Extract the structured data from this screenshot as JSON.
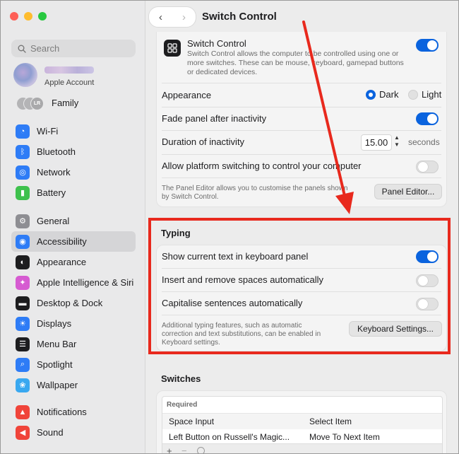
{
  "window": {
    "title": "Switch Control"
  },
  "search": {
    "placeholder": "Search"
  },
  "account": {
    "label": "Apple Account"
  },
  "family": {
    "label": "Family",
    "initials": [
      "",
      "",
      "LR"
    ]
  },
  "sidebar": {
    "group1": [
      {
        "label": "Wi-Fi",
        "icon": "wifi-icon",
        "color": "#2e7cf6"
      },
      {
        "label": "Bluetooth",
        "icon": "bluetooth-icon",
        "color": "#2e7cf6"
      },
      {
        "label": "Network",
        "icon": "globe-icon",
        "color": "#2e7cf6"
      },
      {
        "label": "Battery",
        "icon": "battery-icon",
        "color": "#3ec14d"
      }
    ],
    "group2": [
      {
        "label": "General",
        "icon": "gear-icon",
        "color": "#8e8e93"
      },
      {
        "label": "Accessibility",
        "icon": "accessibility-icon",
        "color": "#2e7cf6",
        "active": true
      },
      {
        "label": "Appearance",
        "icon": "appearance-icon",
        "color": "#1d1d1f"
      },
      {
        "label": "Apple Intelligence & Siri",
        "icon": "siri-icon",
        "color": "#d65bd1"
      },
      {
        "label": "Desktop & Dock",
        "icon": "dock-icon",
        "color": "#1d1d1f"
      },
      {
        "label": "Displays",
        "icon": "sun-icon",
        "color": "#2e7cf6"
      },
      {
        "label": "Menu Bar",
        "icon": "menubar-icon",
        "color": "#1d1d1f"
      },
      {
        "label": "Spotlight",
        "icon": "search-icon",
        "color": "#2e7cf6"
      },
      {
        "label": "Wallpaper",
        "icon": "wallpaper-icon",
        "color": "#39a8f0"
      }
    ],
    "group3": [
      {
        "label": "Notifications",
        "icon": "bell-icon",
        "color": "#f0443a"
      },
      {
        "label": "Sound",
        "icon": "speaker-icon",
        "color": "#f0443a"
      }
    ]
  },
  "switch_control": {
    "title": "Switch Control",
    "description_line1": "Switch Control allows the computer to be controlled using one or",
    "description_line2": "more switches. These can be mouse, keyboard, gamepad buttons",
    "description_line3": "or dedicated devices.",
    "enabled": true
  },
  "appearance": {
    "label": "Appearance",
    "options": [
      "Dark",
      "Light"
    ],
    "selected": "Dark"
  },
  "fade_panel": {
    "label": "Fade panel after inactivity",
    "enabled": true
  },
  "duration": {
    "label": "Duration of inactivity",
    "value": "15.00",
    "unit": "seconds"
  },
  "platform_switching": {
    "label": "Allow platform switching to control your computer",
    "enabled": false
  },
  "panel_editor": {
    "note_line1": "The Panel Editor allows you to customise the panels shown",
    "note_line2": "by Switch Control.",
    "button": "Panel Editor..."
  },
  "typing": {
    "heading": "Typing",
    "rows": [
      {
        "label": "Show current text in keyboard panel",
        "enabled": true
      },
      {
        "label": "Insert and remove spaces automatically",
        "enabled": false
      },
      {
        "label": "Capitalise sentences automatically",
        "enabled": false
      }
    ],
    "note_line1": "Additional typing features, such as automatic",
    "note_line2": "correction and text substitutions, can be enabled in",
    "note_line3": "Keyboard settings.",
    "button": "Keyboard Settings..."
  },
  "switches": {
    "heading": "Switches",
    "group_label": "Required",
    "rows": [
      {
        "input": "Space Input",
        "action": "Select Item"
      },
      {
        "input": "Left Button on Russell's Magic...",
        "action": "Move To Next Item"
      }
    ],
    "footer_add": "+",
    "footer_remove": "−"
  },
  "colors": {
    "accent": "#0a63de",
    "highlight": "#e8291d"
  }
}
